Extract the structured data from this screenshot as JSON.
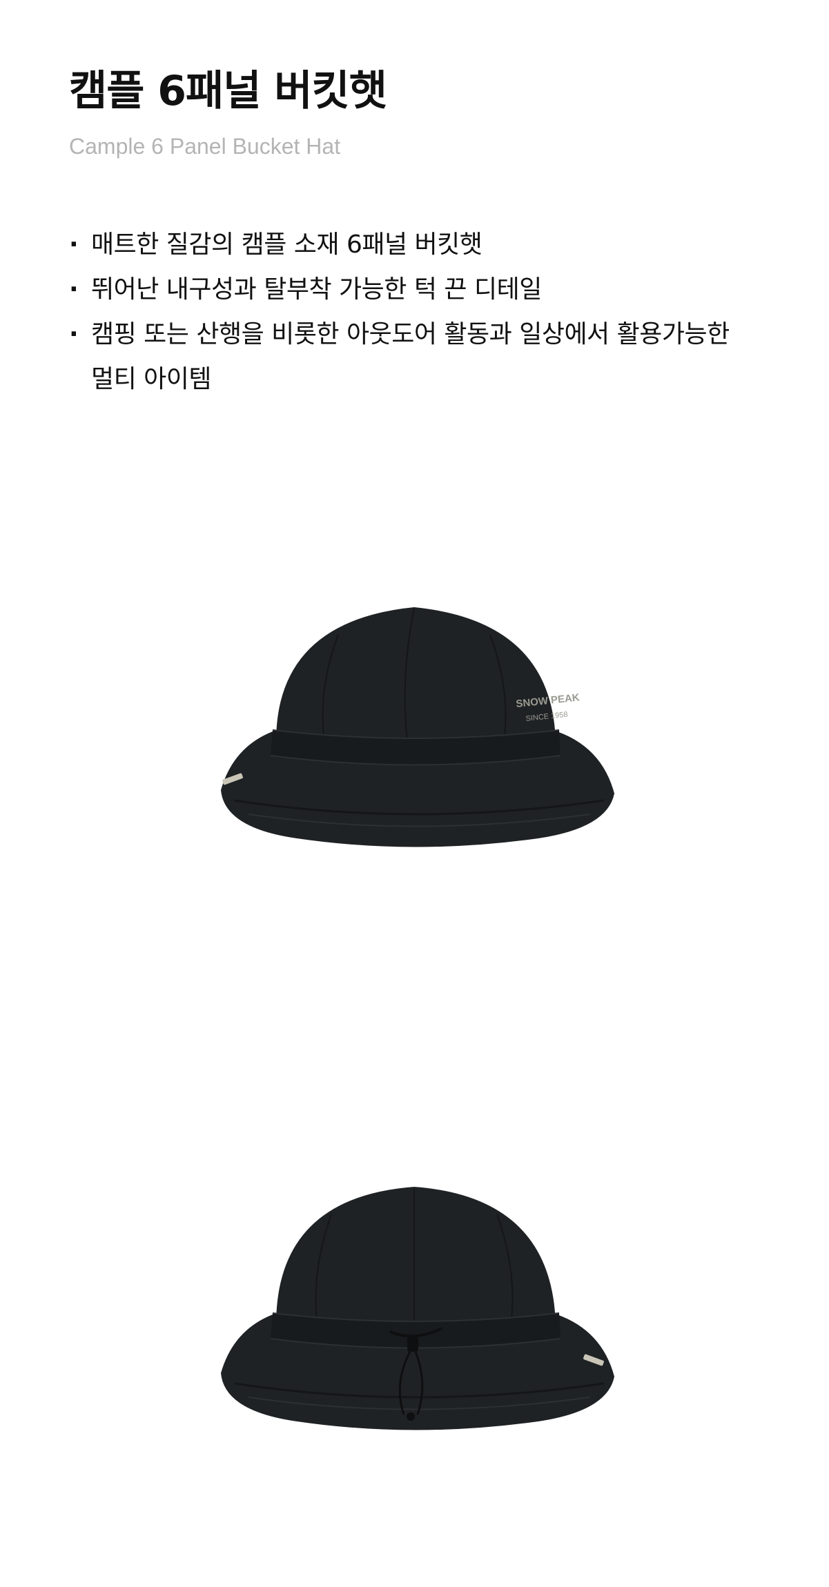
{
  "product": {
    "title": "캠플 6패널 버킷햇",
    "subtitle": "Cample 6 Panel Bucket Hat"
  },
  "features": [
    "매트한 질감의 캠플 소재 6패널 버킷햇",
    "뛰어난 내구성과 탈부착 가능한 턱 끈 디테일",
    "캠핑 또는 산행을 비롯한 아웃도어 활동과 일상에서 활용가능한 멀티 아이템"
  ],
  "images": {
    "front": {
      "logo_line1": "SNOW PEAK",
      "logo_line2": "SINCE 1958"
    }
  },
  "colors": {
    "hat": "#1f2224",
    "hat_shadow": "#141618",
    "hat_highlight": "#2c3033",
    "logo": "#9a9a92",
    "subtitle": "#b4b4b4"
  }
}
